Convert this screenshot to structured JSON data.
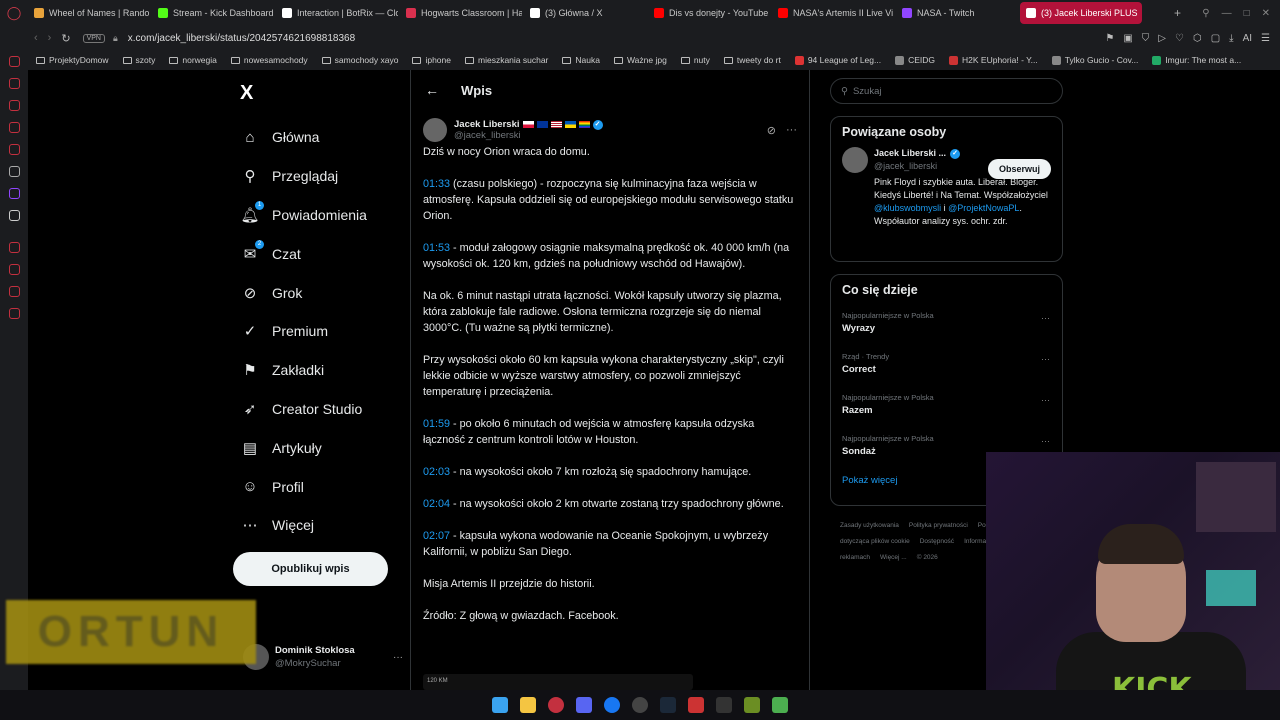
{
  "browser": {
    "tabs": [
      {
        "label": "Wheel of Names | Random",
        "color": "#e8a33b"
      },
      {
        "label": "Stream - Kick Dashboard",
        "color": "#53fc18"
      },
      {
        "label": "Interaction | BotRix — Clo",
        "color": "#ffffff"
      },
      {
        "label": "Hogwarts Classroom | Ha",
        "color": "#d9304e"
      },
      {
        "label": "(3) Główna / X",
        "color": "#ffffff"
      },
      {
        "label": "Dis vs donejty - YouTube",
        "color": "#ff0000"
      },
      {
        "label": "NASA's Artemis II Live Vi",
        "color": "#ff0000"
      },
      {
        "label": "NASA - Twitch",
        "color": "#9146ff"
      },
      {
        "label": "(3) Jacek Liberski PLUS",
        "color": "#ffffff"
      }
    ],
    "vpn": "VPN",
    "url": "x.com/jacek_liberski/status/2042574621698818368",
    "bookmarks": [
      "ProjektyDomow",
      "szoty",
      "norwegia",
      "nowesamochody",
      "samochody xayo",
      "iphone",
      "mieszkania suchar",
      "Nauka",
      "Ważne jpg",
      "nuty",
      "tweety do rt",
      "94 League of Leg...",
      "CEIDG",
      "H2K EUphoria! - Y...",
      "Tylko Gucio - Cov...",
      "Imgur: The most a..."
    ],
    "ai_label": "AI"
  },
  "nav": {
    "logo": "X",
    "items": [
      {
        "label": "Główna",
        "icon": "home-icon",
        "glyph": "⌂"
      },
      {
        "label": "Przeglądaj",
        "icon": "search-icon",
        "glyph": "⚲"
      },
      {
        "label": "Powiadomienia",
        "icon": "bell-icon",
        "glyph": "🔔︎",
        "badge": "1"
      },
      {
        "label": "Czat",
        "icon": "chat-icon",
        "glyph": "✉",
        "badge": "2"
      },
      {
        "label": "Grok",
        "icon": "grok-icon",
        "glyph": "⊘"
      },
      {
        "label": "Premium",
        "icon": "premium-icon",
        "glyph": "✓"
      },
      {
        "label": "Zakładki",
        "icon": "bookmark-icon",
        "glyph": "⚑"
      },
      {
        "label": "Creator Studio",
        "icon": "rocket-icon",
        "glyph": "➶"
      },
      {
        "label": "Artykuły",
        "icon": "article-icon",
        "glyph": "▤"
      },
      {
        "label": "Profil",
        "icon": "profile-icon",
        "glyph": "☺"
      },
      {
        "label": "Więcej",
        "icon": "more-icon",
        "glyph": "⋯"
      }
    ],
    "post_button": "Opublikuj wpis",
    "account": {
      "name": "Dominik Stoklosa",
      "handle": "@MokrySuchar"
    }
  },
  "post": {
    "header": "Wpis",
    "author": {
      "name": "Jacek Liberski",
      "handle": "@jacek_liberski"
    },
    "paragraphs": [
      {
        "time": "",
        "text": "Dziś w nocy Orion wraca do domu."
      },
      {
        "time": "01:33",
        "text": " (czasu polskiego) - rozpoczyna się kulminacyjna faza wejścia w atmosferę. Kapsuła oddzieli się od europejskiego modułu serwisowego statku Orion."
      },
      {
        "time": "01:53",
        "text": " - moduł załogowy osiągnie maksymalną prędkość ok. 40 000 km/h (na wysokości ok. 120 km, gdzieś na południowy wschód od Hawajów)."
      },
      {
        "time": "",
        "text": "Na ok. 6 minut nastąpi utrata łączności. Wokół kapsuły utworzy się plazma, która zablokuje fale radiowe. Osłona termiczna rozgrzeje się do niemal 3000°C. (Tu ważne są płytki termiczne)."
      },
      {
        "time": "",
        "text": "Przy wysokości około 60 km kapsuła wykona charakterystyczny „skip\", czyli lekkie odbicie w wyższe warstwy atmosfery, co pozwoli zmniejszyć temperaturę i przeciążenia."
      },
      {
        "time": "01:59",
        "text": " - po około 6 minutach od wejścia w atmosferę kapsuła odzyska łączność z centrum kontroli lotów w Houston."
      },
      {
        "time": "02:03",
        "text": " - na wysokości około 7 km rozłożą się spadochrony hamujące."
      },
      {
        "time": "02:04",
        "text": " - na wysokości około 2 km otwarte zostaną trzy spadochrony główne."
      },
      {
        "time": "02:07",
        "text": " - kapsuła wykona wodowanie na Oceanie Spokojnym, u wybrzeży Kalifornii, w pobliżu San Diego."
      },
      {
        "time": "",
        "text": "Misja Artemis II przejdzie do historii."
      },
      {
        "time": "",
        "text": "Źródło: Z głową w gwiazdach. Facebook."
      }
    ],
    "media_label": "120 KM"
  },
  "right": {
    "search_placeholder": "Szukaj",
    "related_title": "Powiązane osoby",
    "related": {
      "name": "Jacek Liberski ...",
      "handle": "@jacek_liberski",
      "follow": "Obserwuj",
      "bio_1": "Pink Floyd i szybkie auta. Liberał. Bloger. Kiedyś Liberté! i Na Temat. Współzałożyciel ",
      "bio_link1": "@klubswobmysli",
      "bio_2": " i ",
      "bio_link2": "@ProjektNowaPL",
      "bio_3": ". Współautor analizy sys. ochr. zdr."
    },
    "trends_title": "Co się dzieje",
    "trends": [
      {
        "meta": "Najpopularniejsze w Polska",
        "name": "Wyrazy"
      },
      {
        "meta": "Rząd · Trendy",
        "name": "Correct"
      },
      {
        "meta": "Najpopularniejsze w Polska",
        "name": "Razem"
      },
      {
        "meta": "Najpopularniejsze w Polska",
        "name": "Sondaż"
      }
    ],
    "show_more": "Pokaż więcej",
    "footer": [
      "Zasady użytkowania",
      "Polityka prywatności",
      "Polityka dotycząca plików cookie",
      "Dostępność",
      "Informacja o reklamach",
      "Więcej ...",
      "© 2026"
    ]
  },
  "overlay": {
    "text": "ORTUN"
  },
  "webcam": {
    "shirt_text": "KICK"
  }
}
